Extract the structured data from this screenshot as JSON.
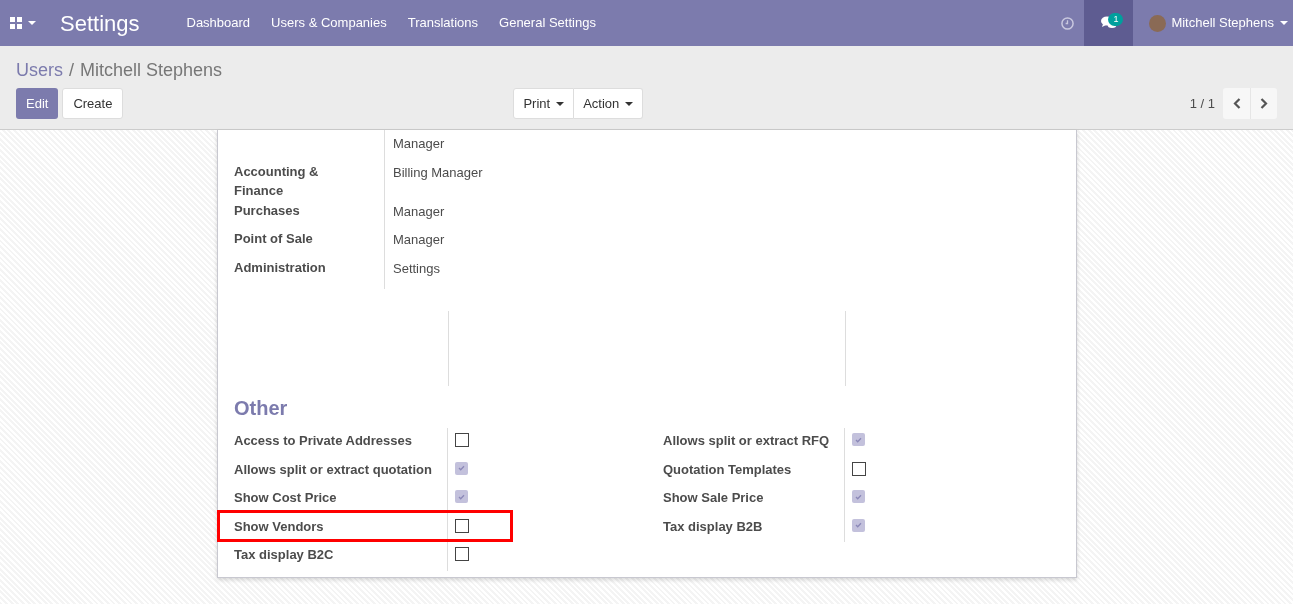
{
  "navbar": {
    "app_title": "Settings",
    "menu": [
      "Dashboard",
      "Users & Companies",
      "Translations",
      "General Settings"
    ],
    "chat_badge": "1",
    "user_name": "Mitchell Stephens"
  },
  "breadcrumb": {
    "parent": "Users",
    "separator": "/",
    "current": "Mitchell Stephens"
  },
  "buttons": {
    "edit": "Edit",
    "create": "Create",
    "print": "Print",
    "action": "Action"
  },
  "pager": "1 / 1",
  "access_rights": [
    {
      "value": "Manager"
    },
    {
      "label": "Accounting & Finance",
      "value": "Billing Manager"
    },
    {
      "label": "Purchases",
      "value": "Manager"
    },
    {
      "label": "Point of Sale",
      "value": "Manager"
    },
    {
      "label": "Administration",
      "value": "Settings"
    }
  ],
  "other": {
    "title": "Other",
    "left": [
      {
        "label": "Access to Private Addresses",
        "checked": false,
        "highlighted": false
      },
      {
        "label": "Allows split or extract quotation",
        "checked": true,
        "highlighted": false
      },
      {
        "label": "Show Cost Price",
        "checked": true,
        "highlighted": false
      },
      {
        "label": "Show Vendors",
        "checked": false,
        "highlighted": true
      },
      {
        "label": "Tax display B2C",
        "checked": false,
        "highlighted": false
      }
    ],
    "right": [
      {
        "label": "Allows split or extract RFQ",
        "checked": true,
        "highlighted": false
      },
      {
        "label": "Quotation Templates",
        "checked": false,
        "highlighted": false
      },
      {
        "label": "Show Sale Price",
        "checked": true,
        "highlighted": false
      },
      {
        "label": "Tax display B2B",
        "checked": true,
        "highlighted": false
      }
    ]
  }
}
